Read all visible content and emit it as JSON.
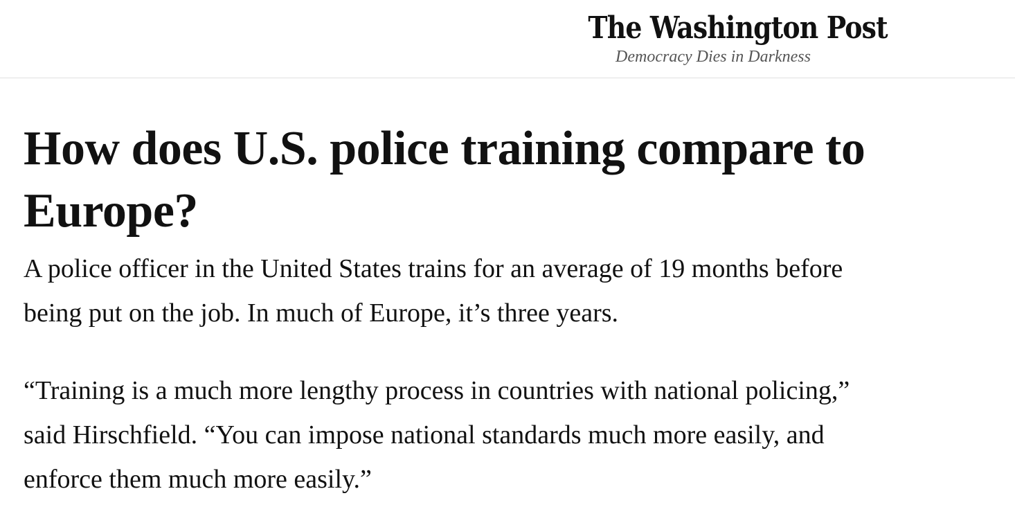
{
  "masthead": {
    "logo_text": "The Washington Post",
    "tagline": "Democracy Dies in Darkness"
  },
  "article": {
    "headline": "How does U.S. police training compare to Europe?",
    "paragraphs": [
      "A police officer in the United States trains for an average of 19 months before being put on the job. In much of Europe, it’s three years.",
      "“Training is a much more lengthy process in countries with national policing,” said Hirschfield. “You can impose national standards much more easily, and enforce them much more easily.”"
    ]
  }
}
